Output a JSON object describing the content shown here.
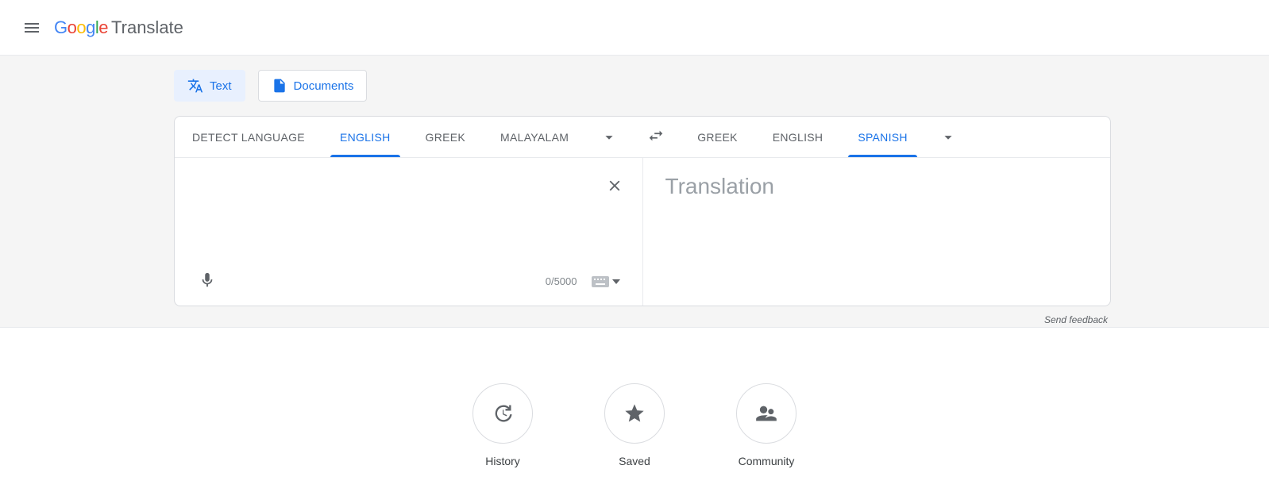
{
  "header": {
    "product": "Translate"
  },
  "modes": {
    "text": "Text",
    "documents": "Documents"
  },
  "source_langs": {
    "detect": "DETECT LANGUAGE",
    "l1": "ENGLISH",
    "l2": "GREEK",
    "l3": "MALAYALAM"
  },
  "target_langs": {
    "l1": "GREEK",
    "l2": "ENGLISH",
    "l3": "SPANISH"
  },
  "io": {
    "input_value": "",
    "char_count": "0/5000",
    "output_placeholder": "Translation"
  },
  "feedback": "Send feedback",
  "actions": {
    "history": "History",
    "saved": "Saved",
    "community": "Community"
  }
}
